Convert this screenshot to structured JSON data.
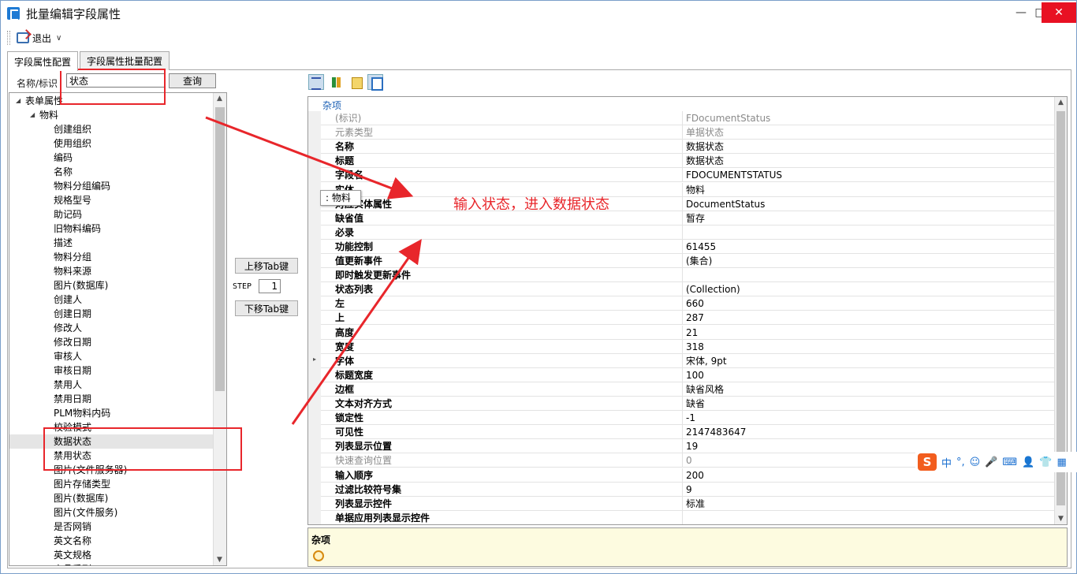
{
  "window": {
    "title": "批量编辑字段属性",
    "min": "—",
    "max": "□",
    "close": "✕"
  },
  "toolbar": {
    "exit_label": "退出",
    "exit_arrow": "∨"
  },
  "tabs": [
    {
      "label": "字段属性配置"
    },
    {
      "label": "字段属性批量配置"
    }
  ],
  "search": {
    "label": "名称/标识",
    "value": "状态",
    "button": "查询"
  },
  "tree": {
    "items": [
      {
        "label": "表单属性",
        "level": 0,
        "toggle": "◢"
      },
      {
        "label": "物料",
        "level": 1,
        "toggle": "◢"
      },
      {
        "label": "创建组织",
        "level": 2
      },
      {
        "label": "使用组织",
        "level": 2
      },
      {
        "label": "编码",
        "level": 2
      },
      {
        "label": "名称",
        "level": 2
      },
      {
        "label": "物料分组编码",
        "level": 2
      },
      {
        "label": "规格型号",
        "level": 2
      },
      {
        "label": "助记码",
        "level": 2
      },
      {
        "label": "旧物料编码",
        "level": 2
      },
      {
        "label": "描述",
        "level": 2
      },
      {
        "label": "物料分组",
        "level": 2
      },
      {
        "label": "物料来源",
        "level": 2
      },
      {
        "label": "图片(数据库)",
        "level": 2
      },
      {
        "label": "创建人",
        "level": 2
      },
      {
        "label": "创建日期",
        "level": 2
      },
      {
        "label": "修改人",
        "level": 2
      },
      {
        "label": "修改日期",
        "level": 2
      },
      {
        "label": "审核人",
        "level": 2
      },
      {
        "label": "审核日期",
        "level": 2
      },
      {
        "label": "禁用人",
        "level": 2
      },
      {
        "label": "禁用日期",
        "level": 2
      },
      {
        "label": "PLM物料内码",
        "level": 2
      },
      {
        "label": "校验模式",
        "level": 2
      },
      {
        "label": "数据状态",
        "level": 2,
        "selected": true
      },
      {
        "label": "禁用状态",
        "level": 2
      },
      {
        "label": "图片(文件服务器)",
        "level": 2
      },
      {
        "label": "图片存储类型",
        "level": 2
      },
      {
        "label": "图片(数据库)",
        "level": 2
      },
      {
        "label": "图片(文件服务)",
        "level": 2
      },
      {
        "label": "是否网销",
        "level": 2
      },
      {
        "label": "英文名称",
        "level": 2
      },
      {
        "label": "英文规格",
        "level": 2
      },
      {
        "label": "产品系列",
        "level": 2
      }
    ]
  },
  "tabctrl": {
    "up": "上移Tab键",
    "step_label": "STEP",
    "step_value": "1",
    "down": "下移Tab键"
  },
  "grid": {
    "category": "杂项",
    "rows": [
      {
        "name": "(标识)",
        "value": "FDocumentStatus",
        "readonly": true
      },
      {
        "name": "元素类型",
        "value": "单据状态",
        "readonly": true
      },
      {
        "name": "名称",
        "value": "数据状态"
      },
      {
        "name": "标题",
        "value": "数据状态"
      },
      {
        "name": "字段名",
        "value": "FDOCUMENTSTATUS"
      },
      {
        "name": "实体",
        "value": "物料"
      },
      {
        "name": "对应实体属性",
        "value": "DocumentStatus"
      },
      {
        "name": "缺省值",
        "value": "暂存"
      },
      {
        "name": "必录",
        "value": "",
        "checkbox": true
      },
      {
        "name": "功能控制",
        "value": "61455"
      },
      {
        "name": "值更新事件",
        "value": "(集合)"
      },
      {
        "name": "即时触发更新事件",
        "value": "",
        "checkbox": true
      },
      {
        "name": "状态列表",
        "value": "(Collection)"
      },
      {
        "name": "左",
        "value": "660"
      },
      {
        "name": "上",
        "value": "287"
      },
      {
        "name": "高度",
        "value": "21"
      },
      {
        "name": "宽度",
        "value": "318"
      },
      {
        "name": "字体",
        "value": "宋体, 9pt",
        "expander": "▸"
      },
      {
        "name": "标题宽度",
        "value": "100"
      },
      {
        "name": "边框",
        "value": "缺省风格"
      },
      {
        "name": "文本对齐方式",
        "value": "缺省"
      },
      {
        "name": "锁定性",
        "value": "-1"
      },
      {
        "name": "可见性",
        "value": "2147483647"
      },
      {
        "name": "列表显示位置",
        "value": "19"
      },
      {
        "name": "快速查询位置",
        "value": "0",
        "readonly": true
      },
      {
        "name": "输入顺序",
        "value": "200"
      },
      {
        "name": "过滤比较符号集",
        "value": "9"
      },
      {
        "name": "列表显示控件",
        "value": "标准"
      },
      {
        "name": "单据应用列表显示控件",
        "value": "",
        "checkbox": true
      }
    ]
  },
  "description": {
    "title": "杂项"
  },
  "tooltip": {
    "text": ": 物料"
  },
  "annotation": {
    "text": "输入状态，进入数据状态",
    "color": "#e8262b"
  },
  "ime": {
    "logo": "S",
    "items": [
      "中",
      "°,",
      "☺",
      "🎤",
      "⌨",
      "👤",
      "👕",
      "▦"
    ]
  }
}
